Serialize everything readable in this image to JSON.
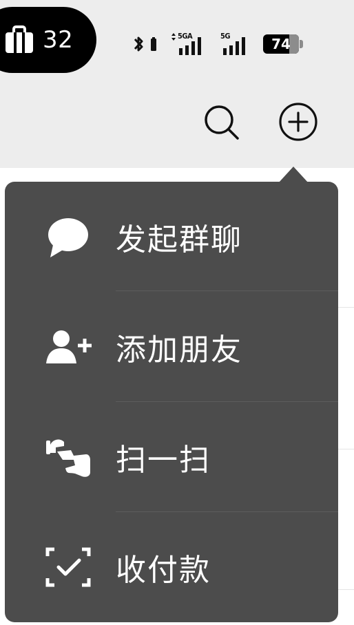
{
  "status_bar": {
    "badge_count": "32",
    "network_1": "5GA",
    "network_2": "5G",
    "battery_level": "74",
    "battery_fraction": 0.74
  },
  "nav_bar": {
    "icons": [
      "search-icon",
      "add-circle-icon"
    ]
  },
  "menu": {
    "items": [
      {
        "label": "发起群聊",
        "icon": "chat-bubble-icon"
      },
      {
        "label": "添加朋友",
        "icon": "add-friend-icon"
      },
      {
        "label": "扫一扫",
        "icon": "scan-icon"
      },
      {
        "label": "收付款",
        "icon": "payment-scan-icon"
      }
    ],
    "background": "#4c4c4c",
    "text_color": "#ffffff"
  }
}
